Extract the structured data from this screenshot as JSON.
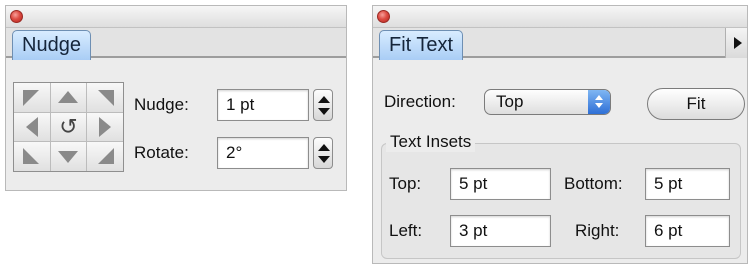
{
  "nudge_panel": {
    "tab_label": "Nudge",
    "nudge_label": "Nudge:",
    "nudge_value": "1 pt",
    "rotate_label": "Rotate:",
    "rotate_value": "2°"
  },
  "fit_text_panel": {
    "tab_label": "Fit Text",
    "direction_label": "Direction:",
    "direction_value": "Top",
    "fit_button_label": "Fit",
    "text_insets_title": "Text Insets",
    "top_label": "Top:",
    "top_value": "5 pt",
    "bottom_label": "Bottom:",
    "bottom_value": "5 pt",
    "left_label": "Left:",
    "left_value": "3 pt",
    "right_label": "Right:",
    "right_value": "6 pt"
  },
  "icons": {
    "rotate_glyph": "↺"
  },
  "colors": {
    "tab_active": "#a9cdf5",
    "close_button": "#dd4c43",
    "popup_accent": "#2e6fd6"
  }
}
